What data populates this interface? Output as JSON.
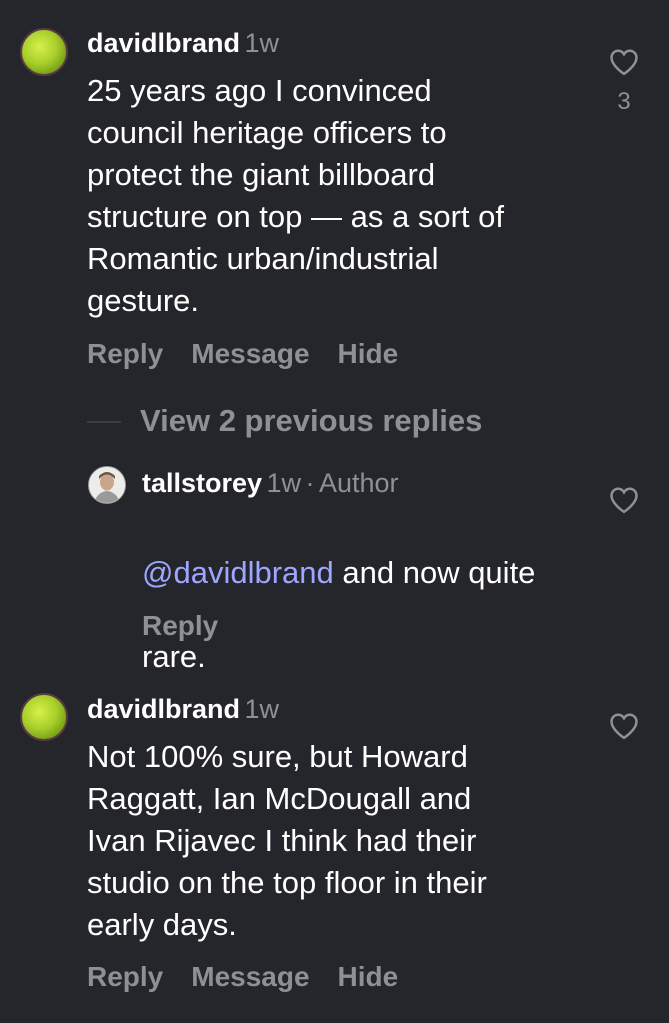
{
  "comments": [
    {
      "username": "davidlbrand",
      "time": "1w",
      "text": "25 years ago I convinced\ncouncil heritage officers to\nprotect the giant billboard\nstructure on top — as a sort of\nRomantic urban/industrial\ngesture.",
      "likes": "3",
      "actions": [
        "Reply",
        "Message",
        "Hide"
      ]
    },
    {
      "username": "davidlbrand",
      "time": "1w",
      "text": "Not 100% sure, but Howard\nRaggatt, Ian McDougall and\nIvan Rijavec I think had their\nstudio on the top floor in their\nearly days.",
      "actions": [
        "Reply",
        "Message",
        "Hide"
      ]
    }
  ],
  "view_previous": "View 2 previous replies",
  "reply": {
    "username": "tallstorey",
    "time": "1w",
    "separator": "·",
    "badge": "Author",
    "mention": "@davidlbrand",
    "text_line1": " and now quite",
    "text_line2": "rare.",
    "action": "Reply"
  },
  "icons": {
    "heart": "heart-outline-icon",
    "avatar_1": "tennis-ball-avatar",
    "avatar_2": "portrait-avatar"
  },
  "colors": {
    "background": "#24262b",
    "secondary_text": "#8e9097",
    "mention": "#9ea6ff"
  }
}
